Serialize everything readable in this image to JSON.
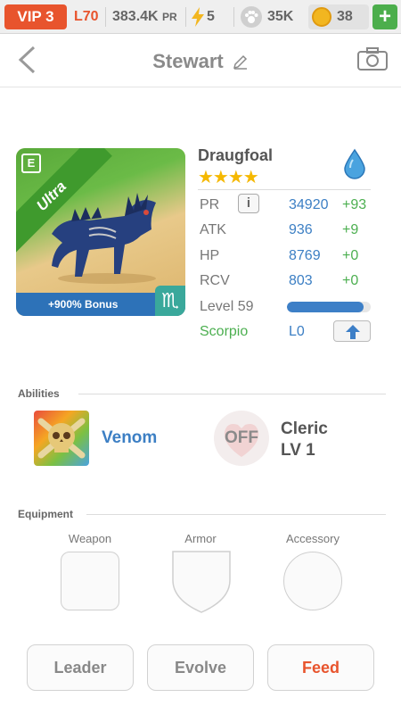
{
  "topbar": {
    "vip": "VIP 3",
    "level": "L70",
    "pr_value": "383.4K",
    "pr_unit": "PR",
    "energy": "5",
    "food": "35K",
    "gold": "38",
    "add": "+"
  },
  "header": {
    "name": "Stewart"
  },
  "monster": {
    "name": "Draugfoal",
    "stars": "★★★★",
    "rarity": "Ultra",
    "bonus": "+900% Bonus",
    "card_badge": "E",
    "zodiac_glyph": "♏",
    "element": "water",
    "stats": [
      {
        "label": "PR",
        "value": "34920",
        "plus": "+93"
      },
      {
        "label": "ATK",
        "value": "936",
        "plus": "+9"
      },
      {
        "label": "HP",
        "value": "8769",
        "plus": "+0"
      },
      {
        "label": "RCV",
        "value": "803",
        "plus": "+0"
      }
    ],
    "info": "i",
    "level": "Level 59",
    "level_progress": 0.92,
    "sign": "Scorpio",
    "sign_level": "L0"
  },
  "abilities": {
    "section_label": "Abilities",
    "items": [
      {
        "name": "Venom"
      },
      {
        "name": "Cleric",
        "level": "LV 1",
        "state": "OFF"
      }
    ]
  },
  "equipment": {
    "section_label": "Equipment",
    "slots": [
      "Weapon",
      "Armor",
      "Accessory"
    ]
  },
  "actions": {
    "leader": "Leader",
    "evolve": "Evolve",
    "feed": "Feed"
  },
  "colors": {
    "accent": "#e8542d",
    "blue": "#3c7fc4",
    "green": "#4caf50",
    "star": "#f5b800"
  }
}
